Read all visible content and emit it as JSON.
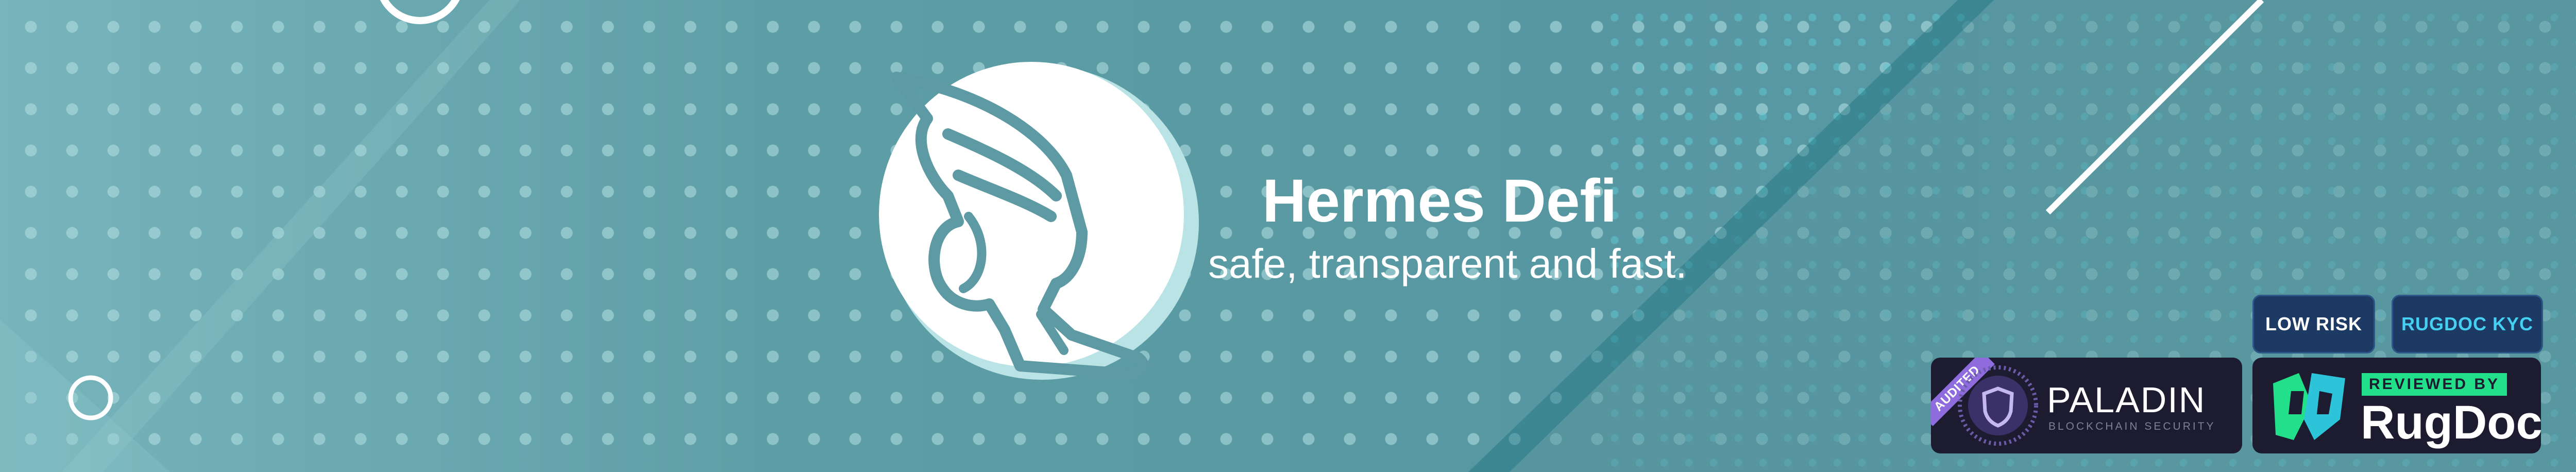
{
  "brand": {
    "title": "Hermes Defi",
    "tagline": "safe, transparent and fast.",
    "logo_icon": "winged-foot-icon"
  },
  "tags": {
    "risk": "LOW RISK",
    "kyc": "RUGDOC KYC"
  },
  "badges": {
    "paladin": {
      "ribbon": "AUDITED",
      "name": "PALADIN",
      "subtitle": "BLOCKCHAIN SECURITY",
      "icon": "shield-icon"
    },
    "rugdoc": {
      "reviewed": "REVIEWED BY",
      "name": "RugDoc",
      "icon": "rugdoc-logo-icon"
    }
  },
  "colors": {
    "background": "#5e9ea6",
    "badge_bg": "#1c1b2f",
    "pill_bg": "#1d3a64",
    "kyc_text": "#45d0f2",
    "rugdoc_green": "#22e08a",
    "paladin_purple": "#8f6cdd"
  }
}
